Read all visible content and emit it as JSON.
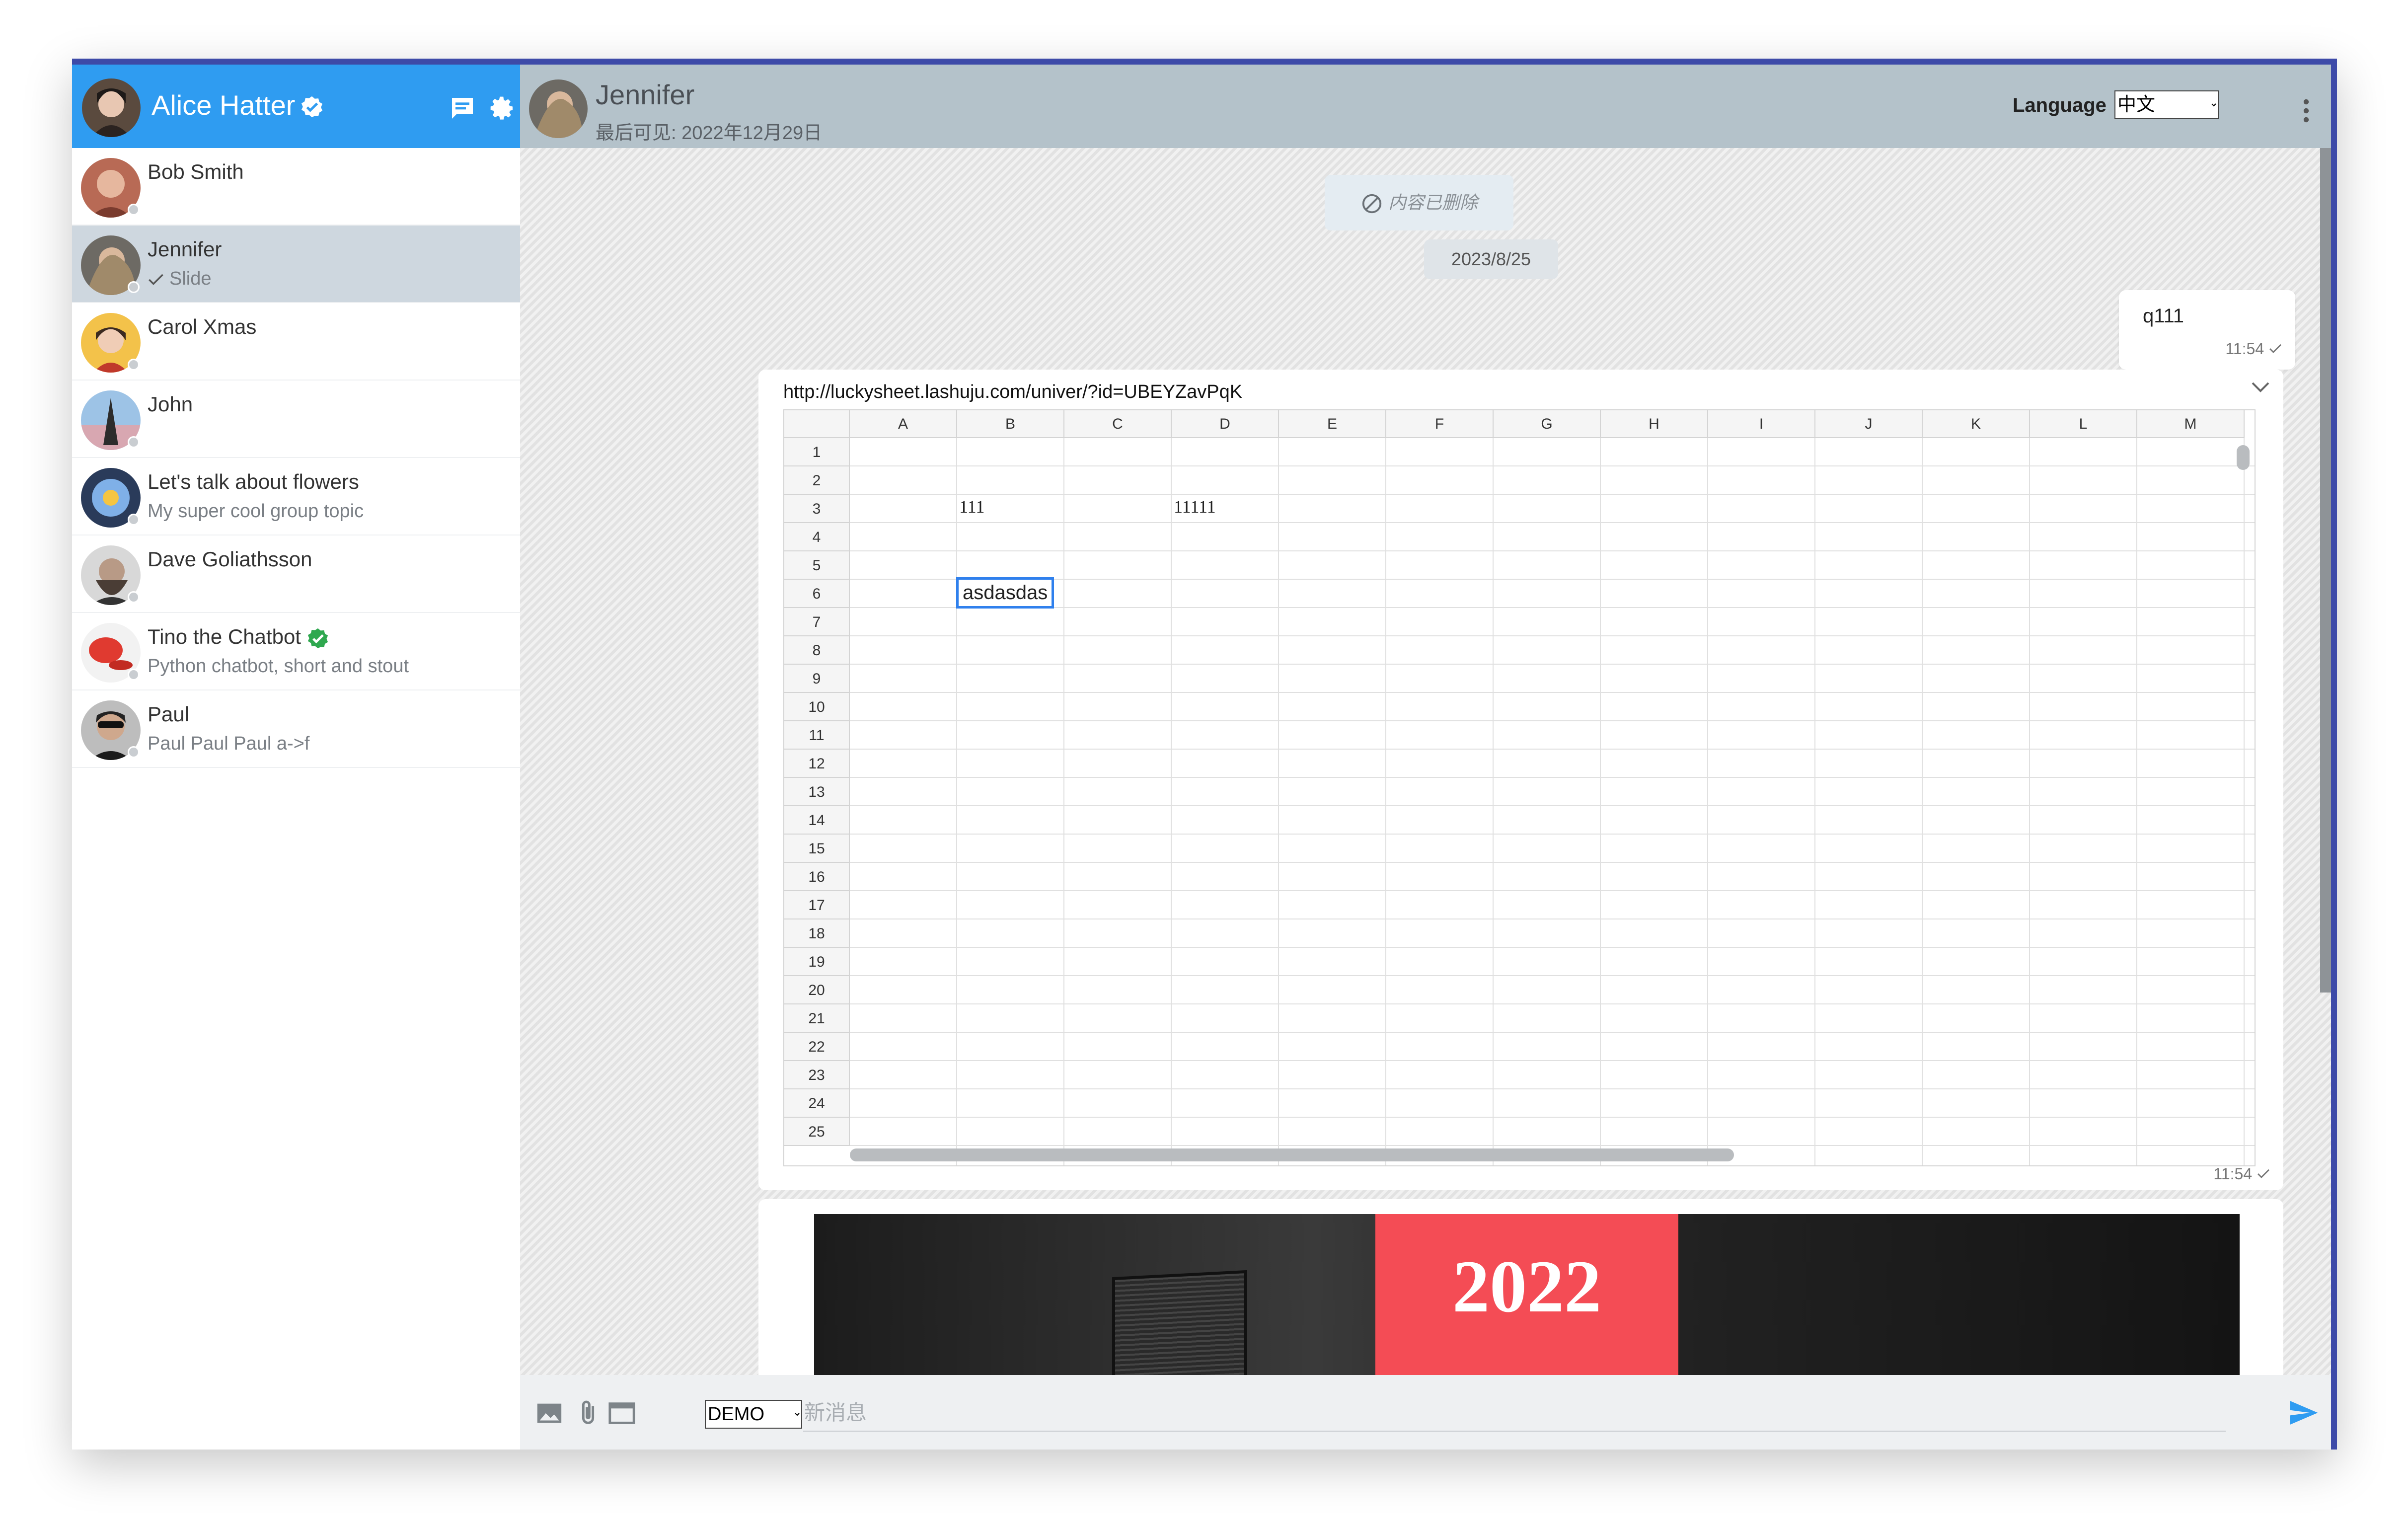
{
  "sidebar": {
    "user_name": "Alice Hatter",
    "contacts": [
      {
        "name": "Bob Smith",
        "sub": ""
      },
      {
        "name": "Jennifer",
        "sub": "Slide"
      },
      {
        "name": "Carol Xmas",
        "sub": ""
      },
      {
        "name": "John",
        "sub": ""
      },
      {
        "name": "Let's talk about flowers",
        "sub": "My super cool group topic"
      },
      {
        "name": "Dave Goliathsson",
        "sub": ""
      },
      {
        "name": "Tino the Chatbot",
        "sub": "Python chatbot, short and stout"
      },
      {
        "name": "Paul",
        "sub": "Paul Paul Paul a->f"
      }
    ]
  },
  "header": {
    "peer_name": "Jennifer",
    "last_seen": "最后可见: 2022年12月29日",
    "language_label": "Language",
    "language_value": "中文"
  },
  "messages": {
    "deleted_text": "内容已删除",
    "date": "2023/8/25",
    "outgoing_text": "q111",
    "outgoing_time": "11:54",
    "card_url": "http://luckysheet.lashuju.com/univer/?id=UBEYZavPqK",
    "card_time": "11:54",
    "banner_year": "2022"
  },
  "spreadsheet": {
    "columns": [
      "A",
      "B",
      "C",
      "D",
      "E",
      "F",
      "G",
      "H",
      "I",
      "J",
      "K",
      "L",
      "M"
    ],
    "rows": [
      "1",
      "2",
      "3",
      "4",
      "5",
      "6",
      "7",
      "8",
      "9",
      "10",
      "11",
      "12",
      "13",
      "14",
      "15",
      "16",
      "17",
      "18",
      "19",
      "20",
      "21",
      "22",
      "23",
      "24",
      "25"
    ],
    "cell_b3": "111",
    "cell_d3": "11111",
    "cell_b6": "asdasdas"
  },
  "composer": {
    "mode_value": "DEMO",
    "placeholder": "新消息"
  },
  "colors": {
    "accent": "#2f9cf1",
    "header_bar": "#b4c2ca",
    "active_contact": "#ced7df",
    "verified_green": "#2fa84f",
    "banner_red": "#f44c55"
  }
}
